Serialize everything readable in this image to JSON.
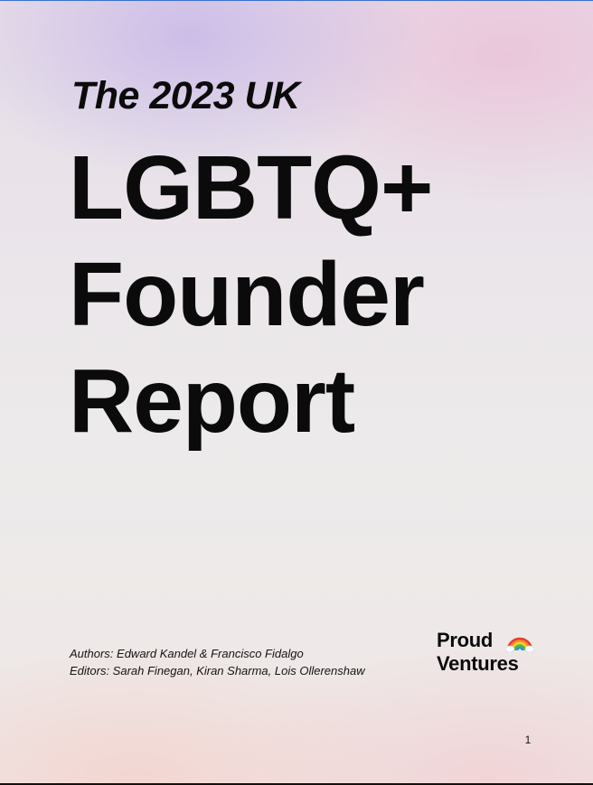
{
  "cover": {
    "kicker": "The 2023 UK",
    "headline_lines": [
      "LGBTQ+",
      "Founder",
      "Report"
    ]
  },
  "credits": {
    "authors": "Authors: Edward Kandel & Francisco Fidalgo",
    "editors": "Editors: Sarah Finegan, Kiran Sharma, Lois Ollerenshaw"
  },
  "logo": {
    "line1": "Proud",
    "line2": "Ventures",
    "icon": "rainbow-icon",
    "rainbow_colors": [
      "#e8372f",
      "#f28a25",
      "#f6cf2b",
      "#46b649",
      "#2f8fd8",
      "#7a4bc2"
    ]
  },
  "footer": {
    "page_number": "1"
  }
}
